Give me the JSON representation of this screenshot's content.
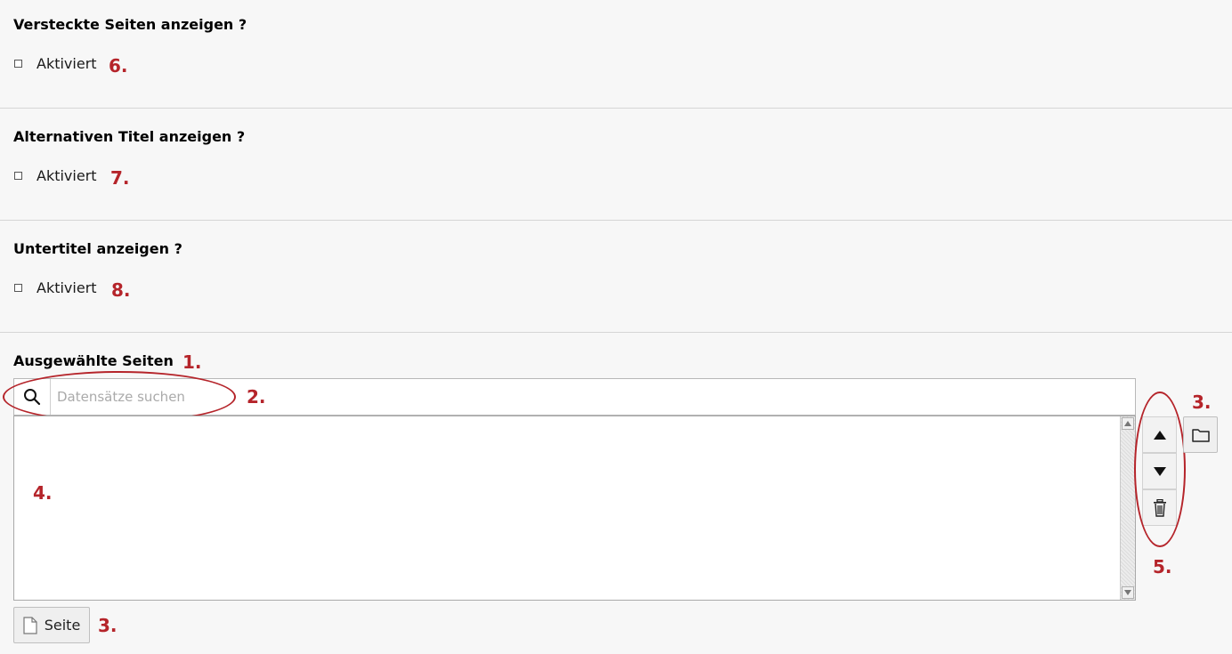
{
  "sections": [
    {
      "heading": "Versteckte Seiten anzeigen ?",
      "checkbox_label": "Aktiviert",
      "marker": "6."
    },
    {
      "heading": "Alternativen Titel anzeigen ?",
      "checkbox_label": "Aktiviert",
      "marker": "7."
    },
    {
      "heading": "Untertitel anzeigen ?",
      "checkbox_label": "Aktiviert",
      "marker": "8."
    }
  ],
  "selected_pages": {
    "heading": "Ausgewählte Seiten",
    "heading_marker": "1.",
    "search_placeholder": "Datensätze suchen",
    "search_marker": "2.",
    "browse_marker": "3.",
    "list_marker": "4.",
    "controls_marker": "5.",
    "add_button_label": "Seite",
    "add_button_marker": "3."
  },
  "colors": {
    "annotation": "#b5242a",
    "background": "#f7f7f7"
  },
  "icons": [
    "search-icon",
    "folder-icon",
    "arrow-up-icon",
    "arrow-down-icon",
    "trash-icon",
    "page-icon"
  ]
}
